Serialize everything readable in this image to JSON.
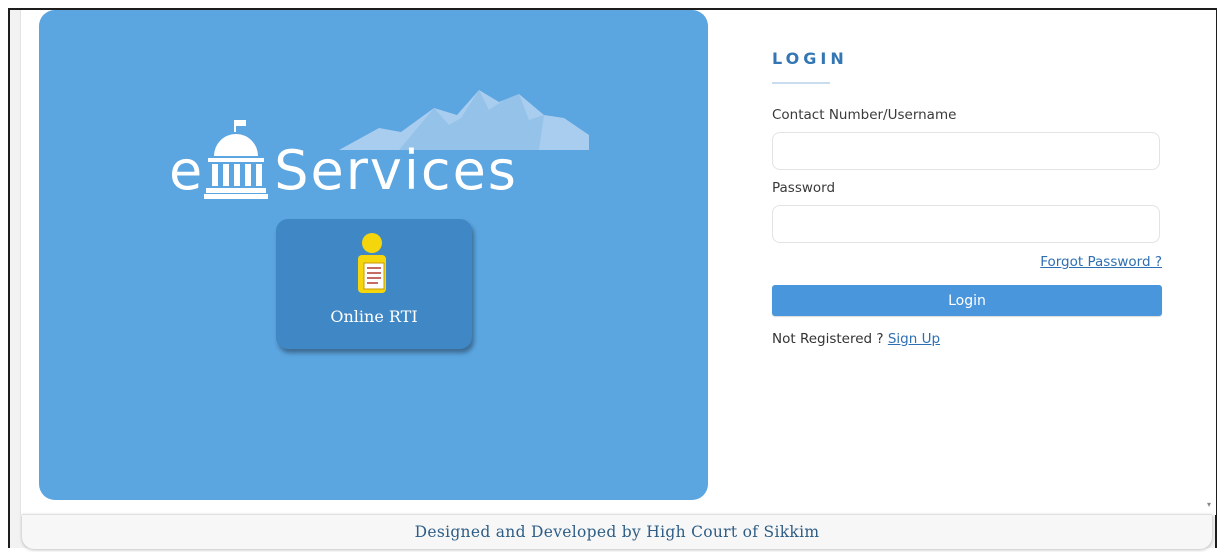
{
  "hero": {
    "brand_prefix": "e",
    "brand_name": "Services",
    "tiles": [
      {
        "label": "Online RTI",
        "icon": "person-document-icon"
      }
    ],
    "colors": {
      "panel": "#5ba5e1",
      "tile": "#3f87c5"
    }
  },
  "login": {
    "title": "LOGIN",
    "username_label": "Contact Number/Username",
    "username_value": "",
    "password_label": "Password",
    "password_value": "",
    "forgot_password": "Forgot Password ?",
    "login_button": "Login",
    "not_registered": "Not Registered ?",
    "sign_up": "Sign Up",
    "colors": {
      "button": "#4a96dc",
      "link": "#2e6fb2",
      "title": "#3476b4"
    }
  },
  "footer": {
    "text": "Designed and Developed by High Court of Sikkim"
  }
}
